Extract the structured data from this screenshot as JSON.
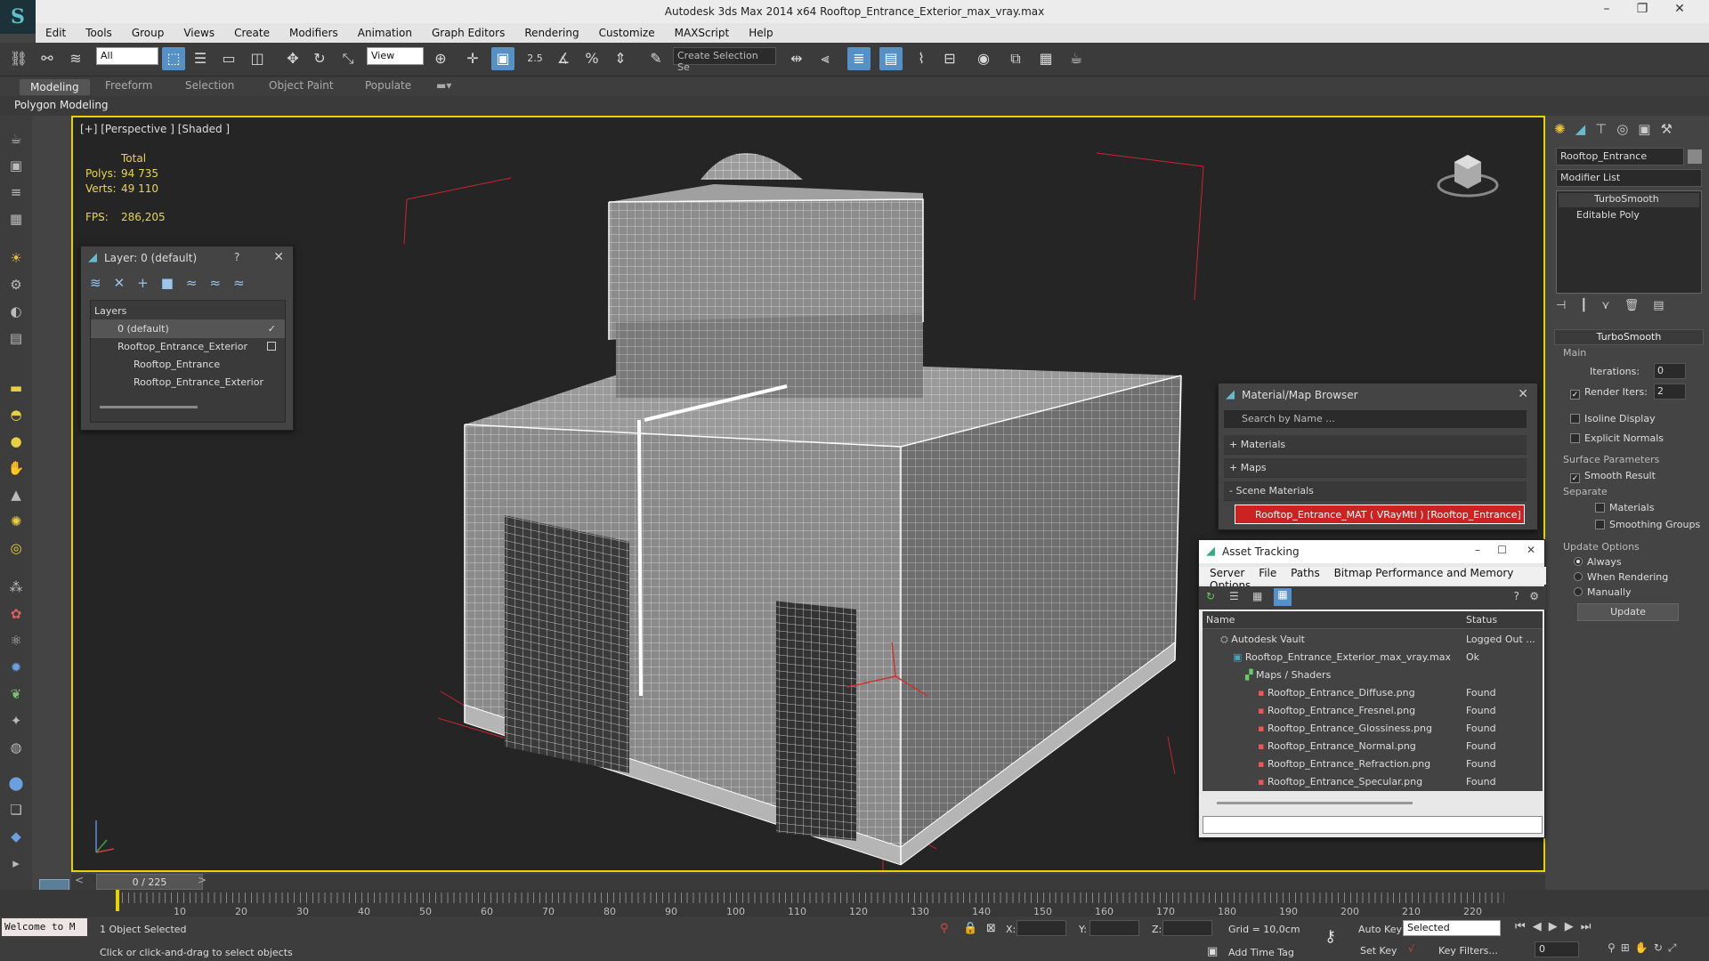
{
  "window": {
    "title": "Autodesk 3ds Max  2014 x64     Rooftop_Entrance_Exterior_max_vray.max"
  },
  "menu": [
    "Edit",
    "Tools",
    "Group",
    "Views",
    "Create",
    "Modifiers",
    "Animation",
    "Graph Editors",
    "Rendering",
    "Customize",
    "MAXScript",
    "Help"
  ],
  "toolbar": {
    "filter": "All",
    "coord": "View",
    "selection_set": "Create Selection Se",
    "snap_value": "2.5"
  },
  "ribbon": {
    "tabs": [
      "Modeling",
      "Freeform",
      "Selection",
      "Object Paint",
      "Populate"
    ],
    "panel": "Polygon Modeling"
  },
  "viewport": {
    "label": "[+] [Perspective ] [Shaded ]",
    "stats": {
      "header": "Total",
      "polys_label": "Polys:",
      "polys": "94 735",
      "verts_label": "Verts:",
      "verts": "49 110",
      "fps_label": "FPS:",
      "fps": "286,205"
    }
  },
  "layer_dialog": {
    "title": "Layer: 0 (default)",
    "help": "?",
    "header": "Layers",
    "rows": [
      "0 (default)",
      "Rooftop_Entrance_Exterior",
      "Rooftop_Entrance",
      "Rooftop_Entrance_Exterior"
    ]
  },
  "material_browser": {
    "title": "Material/Map Browser",
    "search_placeholder": "Search by Name ...",
    "sections": [
      "+ Materials",
      "+ Maps",
      "- Scene Materials"
    ],
    "selected_item": "Rooftop_Entrance_MAT  ( VRayMtl )  [Rooftop_Entrance]"
  },
  "asset_tracking": {
    "title": "Asset Tracking",
    "menu": [
      "Server",
      "File",
      "Paths",
      "Bitmap Performance and Memory",
      "Options"
    ],
    "columns": {
      "name": "Name",
      "status": "Status"
    },
    "rows": [
      {
        "name": "Autodesk Vault",
        "status": "Logged Out ..."
      },
      {
        "name": "Rooftop_Entrance_Exterior_max_vray.max",
        "status": "Ok"
      },
      {
        "name": "Maps / Shaders",
        "status": ""
      },
      {
        "name": "Rooftop_Entrance_Diffuse.png",
        "status": "Found"
      },
      {
        "name": "Rooftop_Entrance_Fresnel.png",
        "status": "Found"
      },
      {
        "name": "Rooftop_Entrance_Glossiness.png",
        "status": "Found"
      },
      {
        "name": "Rooftop_Entrance_Normal.png",
        "status": "Found"
      },
      {
        "name": "Rooftop_Entrance_Refraction.png",
        "status": "Found"
      },
      {
        "name": "Rooftop_Entrance_Specular.png",
        "status": "Found"
      }
    ]
  },
  "command_panel": {
    "object_name": "Rooftop_Entrance",
    "modifier_list": "Modifier List",
    "stack": [
      "TurboSmooth",
      "Editable Poly"
    ],
    "rollout": "TurboSmooth",
    "main_label": "Main",
    "iterations_label": "Iterations:",
    "iterations": "0",
    "render_iters_label": "Render Iters:",
    "render_iters": "2",
    "isoline": "Isoline Display",
    "explicit_normals": "Explicit Normals",
    "surface_params": "Surface Parameters",
    "smooth_result": "Smooth Result",
    "separate": "Separate",
    "materials": "Materials",
    "smoothing_groups": "Smoothing Groups",
    "update_options": "Update Options",
    "always": "Always",
    "when_rendering": "When Rendering",
    "manually": "Manually",
    "update_button": "Update"
  },
  "timeline": {
    "slider": "0 / 225",
    "ticks": [
      "10",
      "20",
      "30",
      "40",
      "50",
      "60",
      "70",
      "80",
      "90",
      "100",
      "110",
      "120",
      "130",
      "140",
      "150",
      "160",
      "170",
      "180",
      "190",
      "200",
      "210",
      "220"
    ]
  },
  "status": {
    "welcome": "Welcome to M",
    "selection": "1 Object Selected",
    "prompt": "Click or click-and-drag to select objects",
    "x_label": "X:",
    "y_label": "Y:",
    "z_label": "Z:",
    "grid": "Grid = 10,0cm",
    "add_time_tag": "Add Time Tag",
    "auto_key": "Auto Key",
    "set_key": "Set Key",
    "selected": "Selected",
    "key_filters": "Key Filters...",
    "frame": "0"
  },
  "colors": {
    "accent": "#5591c6",
    "viewport_border": "#e6d400",
    "stats": "#e8d650",
    "selected_material": "#cc2222"
  }
}
